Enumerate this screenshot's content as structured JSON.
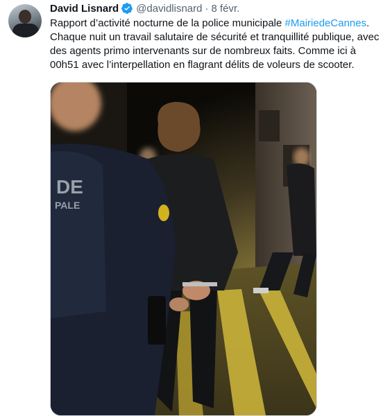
{
  "tweet": {
    "author_name": "David Lisnard",
    "handle": "@davidlisnard",
    "separator": "·",
    "date": "8 févr.",
    "text_part1": "Rapport d’activité nocturne de la police municipale ",
    "hashtag": "#MairiedeCannes",
    "text_part2": ". Chaque nuit un travail salutaire de sécurité et tranquillité publique, avec des agents primo intervenants sur de nombreux faits. Comme ici à 00h51 avec l’interpellation en flagrant délits de voleurs de scooter.",
    "photo_text": {
      "patch_line1": "DE",
      "patch_line2": "PALE"
    }
  },
  "icons": {
    "avatar": "profile-photo",
    "verified": "verified-badge-icon"
  },
  "colors": {
    "link": "#1d9bf0",
    "verified": "#1d9bf0",
    "secondary_text": "#536471"
  }
}
